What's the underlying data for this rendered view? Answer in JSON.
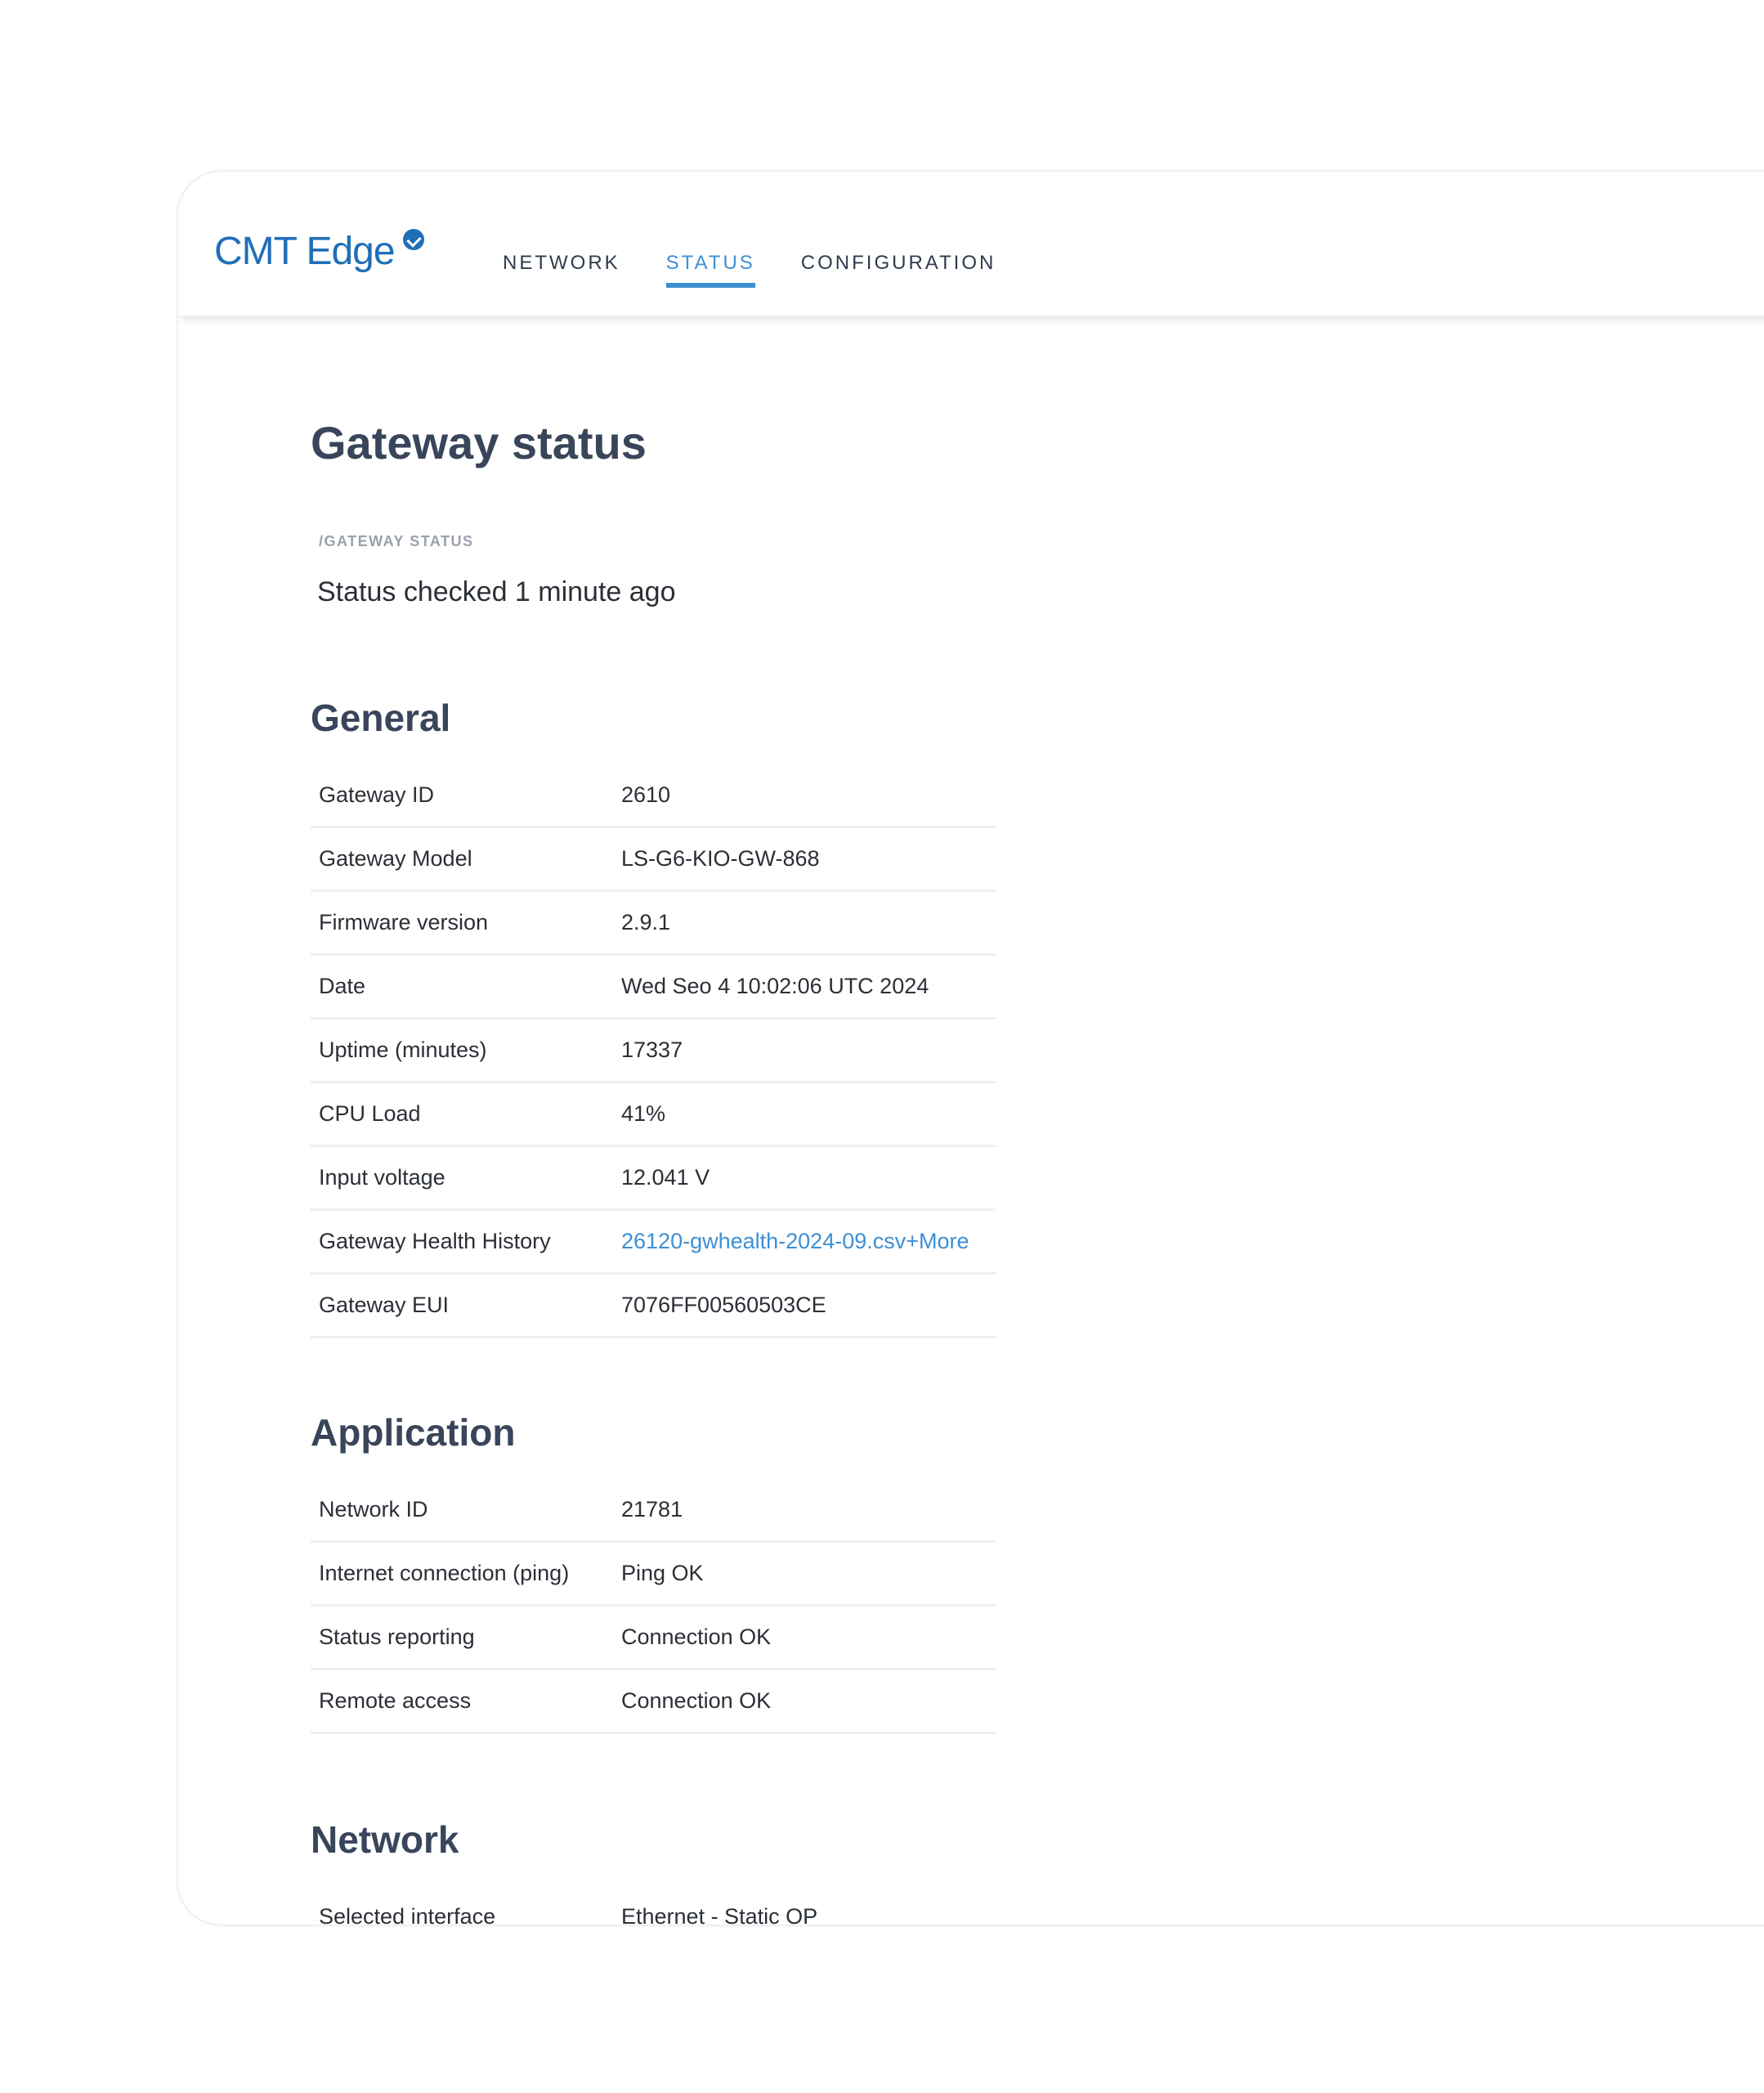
{
  "brand": {
    "name": "CMT Edge"
  },
  "nav": {
    "tabs": [
      {
        "label": "NETWORK",
        "active": false
      },
      {
        "label": "STATUS",
        "active": true
      },
      {
        "label": "CONFIGURATION",
        "active": false
      }
    ]
  },
  "page": {
    "title": "Gateway status",
    "breadcrumb": "/GATEWAY STATUS",
    "checked": "Status checked 1 minute ago"
  },
  "general": {
    "title": "General",
    "rows": [
      {
        "key": "Gateway ID",
        "value": "2610"
      },
      {
        "key": "Gateway Model",
        "value": "LS-G6-KIO-GW-868"
      },
      {
        "key": "Firmware version",
        "value": "2.9.1"
      },
      {
        "key": "Date",
        "value": "Wed Seo 4 10:02:06 UTC 2024"
      },
      {
        "key": "Uptime (minutes)",
        "value": "17337"
      },
      {
        "key": "CPU Load",
        "value": "41%"
      },
      {
        "key": "Input voltage",
        "value": "12.041 V"
      },
      {
        "key": "Gateway Health History",
        "value": "26120-gwhealth-2024-09.csv+More"
      },
      {
        "key": "Gateway EUI",
        "value": "7076FF00560503CE"
      }
    ]
  },
  "application": {
    "title": "Application",
    "rows": [
      {
        "key": "Network ID",
        "value": "21781"
      },
      {
        "key": "Internet connection (ping)",
        "value": "Ping OK"
      },
      {
        "key": "Status reporting",
        "value": "Connection OK"
      },
      {
        "key": "Remote access",
        "value": "Connection OK"
      }
    ]
  },
  "network": {
    "title": "Network",
    "rows": [
      {
        "key": "Selected interface",
        "value": "Ethernet - Static OP"
      }
    ]
  },
  "colors": {
    "brand": "#1f6fb7",
    "accent": "#3d8fd4",
    "heading": "#39455a"
  }
}
